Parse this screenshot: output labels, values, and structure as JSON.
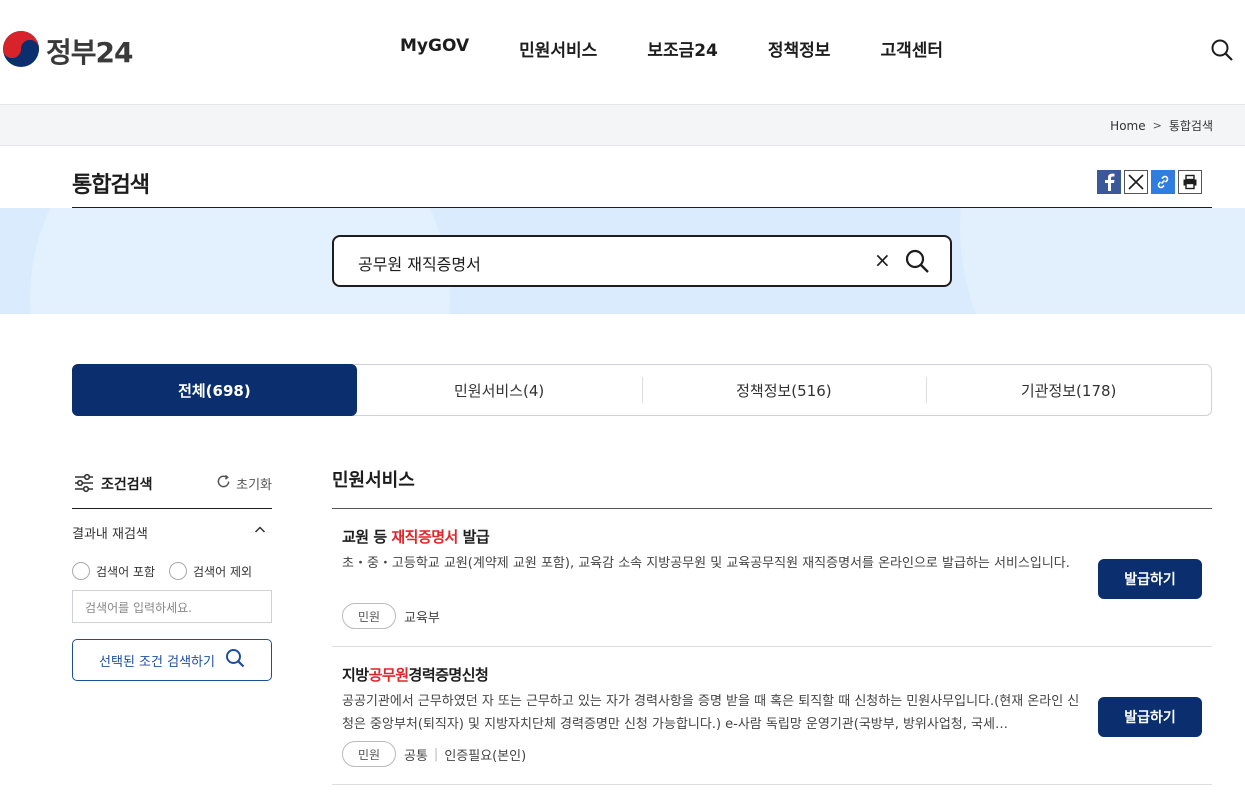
{
  "header": {
    "logo_text": "정부24",
    "nav": [
      "MyGOV",
      "민원서비스",
      "보조금24",
      "정책정보",
      "고객센터"
    ]
  },
  "breadcrumb": {
    "home": "Home",
    "current": "통합검색"
  },
  "page_title": "통합검색",
  "search": {
    "value": "공무원 재직증명서",
    "clear": "×"
  },
  "tabs": [
    "전체(698)",
    "민원서비스(4)",
    "정책정보(516)",
    "기관정보(178)"
  ],
  "sidebar": {
    "title": "조건검색",
    "reset": "초기화",
    "research_title": "결과내 재검색",
    "include": "검색어 포함",
    "exclude": "검색어 제외",
    "keyword_placeholder": "검색어를 입력하세요.",
    "apply": "선택된 조건 검색하기"
  },
  "results": {
    "section_title": "민원서비스",
    "items": [
      {
        "title_pre": "교원 등 ",
        "title_hl": "재직증명서",
        "title_post": " 발급",
        "desc": "초・중・고등학교 교원(계약제 교원 포함), 교육감 소속 지방공무원 및 교육공무직원 재직증명서를 온라인으로 발급하는 서비스입니다.",
        "badge": "민원",
        "org": "교육부",
        "extra": "",
        "button": "발급하기"
      },
      {
        "title_pre": "지방",
        "title_hl": "공무원",
        "title_post": "경력증명신청",
        "desc": "공공기관에서 근무하였던 자 또는 근무하고 있는 자가 경력사항을 증명 받을 때 혹은 퇴직할 때 신청하는 민원사무입니다.(현재 온라인 신청은 중앙부처(퇴직자) 및 지방자치단체 경력증명만 신청 가능합니다.) e-사람 독립망 운영기관(국방부, 방위사업청, 국세…",
        "badge": "민원",
        "org": "공통",
        "extra": "인증필요(본인)",
        "button": "발급하기"
      }
    ]
  }
}
